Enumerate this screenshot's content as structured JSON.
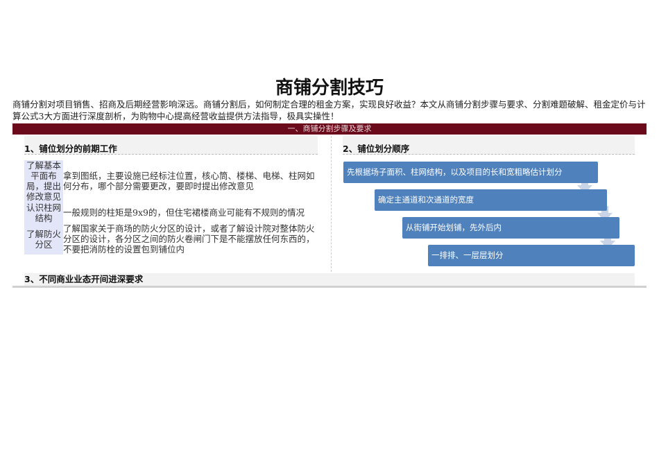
{
  "title": "商铺分割技巧",
  "intro": "商铺分割对项目销售、招商及后期经营影响深远。商铺分割后，如何制定合理的租金方案，实现良好收益？本文从商铺分割步骤与要求、分割难题破解、租金定价与计算公式3大方面进行深度剖析，为购物中心提高经营收益提供方法指导，极具实操性！",
  "banner": "一、商铺分割步骤及要求",
  "left": {
    "heading": "1、铺位划分的前期工作",
    "rows": [
      {
        "label": "了解基本平面布局，提出修改意见",
        "text": "拿到图纸，主要设施已经标注位置，核心筒、楼梯、电梯、柱网如何分布，哪个部分需要更改，要即时提出修改意见"
      },
      {
        "label": "认识柱网结构",
        "text": "一般规则的柱矩是9x9的，但住宅裙楼商业可能有不规则的情况"
      },
      {
        "label": "了解防火分区",
        "text": "了解国家关于商场的防火分区的设计，或者了解设计院对整体防火分区的设计，各分区之间的防火卷闸门下是不能摆放任何东西的，不要把消防栓的设置包到铺位内"
      }
    ]
  },
  "right": {
    "heading": "2、铺位划分顺序",
    "steps": [
      "先根据场子面积、柱网结构，以及项目的长和宽粗略估计划分",
      "确定主通道和次通道的宽度",
      "从街铺开始划铺，先外后内",
      "一排排、一层层划分"
    ]
  },
  "section3": {
    "heading": "3、不同商业业态开间进深要求"
  },
  "colors": {
    "banner": "#6b0a1a",
    "step": "#4f81bd",
    "label_bg": "#e3e6f8"
  }
}
